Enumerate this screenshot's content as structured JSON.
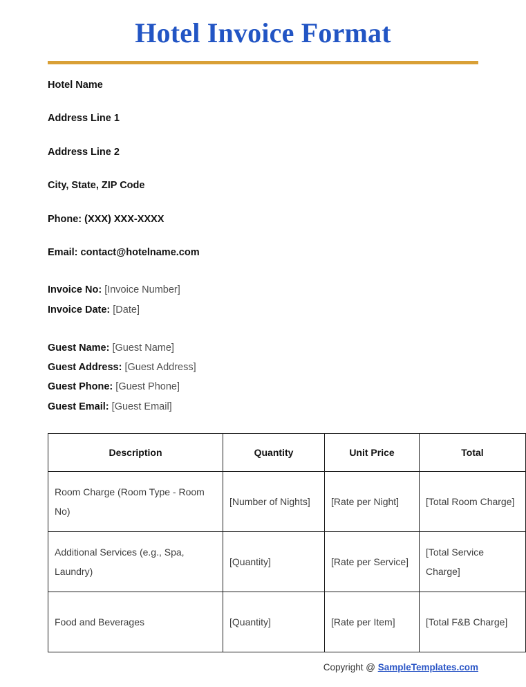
{
  "document": {
    "title": "Hotel Invoice Format",
    "accent_color": "#2255c4",
    "rule_color": "#d9a036"
  },
  "hotel_info": {
    "lines": [
      "Hotel Name",
      "Address Line 1",
      "Address Line 2",
      "City, State, ZIP Code",
      "Phone: (XXX) XXX-XXXX",
      "Email: contact@hotelname.com"
    ]
  },
  "invoice_meta": {
    "rows": [
      {
        "label": "Invoice No:",
        "value": "[Invoice Number]"
      },
      {
        "label": "Invoice Date:",
        "value": "[Date]"
      }
    ]
  },
  "guest_meta": {
    "rows": [
      {
        "label": "Guest Name:",
        "value": "[Guest Name]"
      },
      {
        "label": "Guest Address:",
        "value": "[Guest Address]"
      },
      {
        "label": "Guest Phone:",
        "value": "[Guest Phone]"
      },
      {
        "label": "Guest Email:",
        "value": "[Guest Email]"
      }
    ]
  },
  "line_items_table": {
    "headers": [
      "Description",
      "Quantity",
      "Unit Price",
      "Total"
    ],
    "rows": [
      {
        "description": "Room Charge (Room Type - Room No)",
        "quantity": "[Number of Nights]",
        "unit_price": "[Rate per Night]",
        "total": "[Total Room Charge]"
      },
      {
        "description": "Additional Services (e.g., Spa, Laundry)",
        "quantity": "[Quantity]",
        "unit_price": "[Rate per Service]",
        "total": "[Total Service Charge]"
      },
      {
        "description": "Food and Beverages",
        "quantity": "[Quantity]",
        "unit_price": "[Rate per Item]",
        "total": "[Total F&B Charge]"
      }
    ]
  },
  "footer": {
    "copyright_text": "Copyright @ ",
    "link_text": "SampleTemplates.com",
    "link_color": "#2b56c6"
  }
}
